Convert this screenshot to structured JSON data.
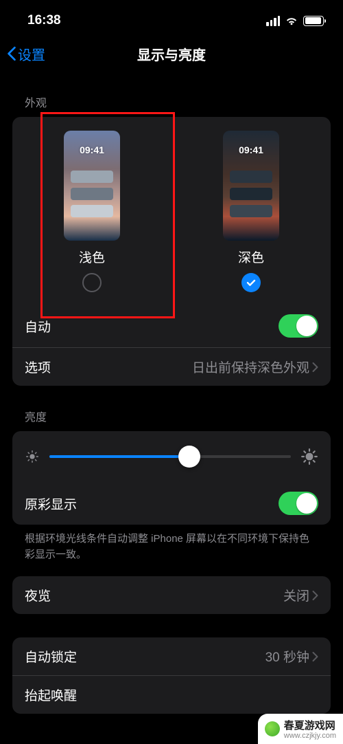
{
  "status": {
    "time": "16:38"
  },
  "nav": {
    "back": "设置",
    "title": "显示与亮度"
  },
  "appearance": {
    "header": "外观",
    "preview_time": "09:41",
    "light_label": "浅色",
    "dark_label": "深色",
    "auto_label": "自动",
    "options_label": "选项",
    "options_value": "日出前保持深色外观"
  },
  "brightness": {
    "header": "亮度",
    "truetone_label": "原彩显示",
    "truetone_note": "根据环境光线条件自动调整 iPhone 屏幕以在不同环境下保持色彩显示一致。"
  },
  "night_shift": {
    "label": "夜览",
    "value": "关闭"
  },
  "auto_lock": {
    "label": "自动锁定",
    "value": "30 秒钟"
  },
  "raise_to_wake": {
    "label": "抬起唤醒"
  },
  "watermark": {
    "text": "春夏游戏网",
    "url": "www.czjkjy.com"
  }
}
